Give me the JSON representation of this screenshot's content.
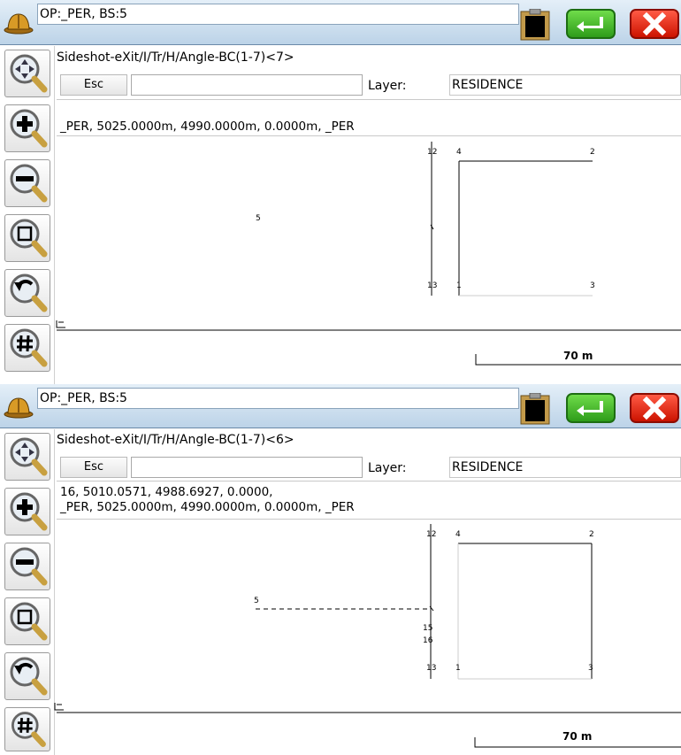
{
  "panels": [
    {
      "title": "OP:_PER, BS:5",
      "prompt": "Sideshot-eXit/I/Tr/H/Angle-BC(1-7)<7>",
      "esc_label": "Esc",
      "layer_label": "Layer:",
      "layer_value": "RESIDENCE",
      "messages": [
        "_PER, 5025.0000m, 4990.0000m, 0.0000m, _PER"
      ],
      "scale_label": "70 m",
      "point_labels": {
        "p12": "12",
        "p4": "4",
        "p2": "2",
        "p5": "5",
        "p13": "13",
        "p1": "1",
        "p3": "3"
      }
    },
    {
      "title": "OP:_PER, BS:5",
      "prompt": "Sideshot-eXit/I/Tr/H/Angle-BC(1-7)<6>",
      "esc_label": "Esc",
      "layer_label": "Layer:",
      "layer_value": "RESIDENCE",
      "messages": [
        "16, 5010.0571, 4988.6927, 0.0000,",
        "_PER, 5025.0000m, 4990.0000m, 0.0000m, _PER"
      ],
      "scale_label": "70 m",
      "point_labels": {
        "p12": "12",
        "p4": "4",
        "p2": "2",
        "p5": "5",
        "p15": "15",
        "p16": "16",
        "p13": "13",
        "p1": "1",
        "p3": "3"
      }
    }
  ],
  "toolbar": [
    "pan-zoom",
    "zoom-in",
    "zoom-out",
    "zoom-window",
    "zoom-previous",
    "zoom-grid"
  ],
  "icons": {
    "hat": "hardhat-icon",
    "clipboard": "clipboard-icon",
    "ok": "enter-icon",
    "close": "close-icon"
  }
}
